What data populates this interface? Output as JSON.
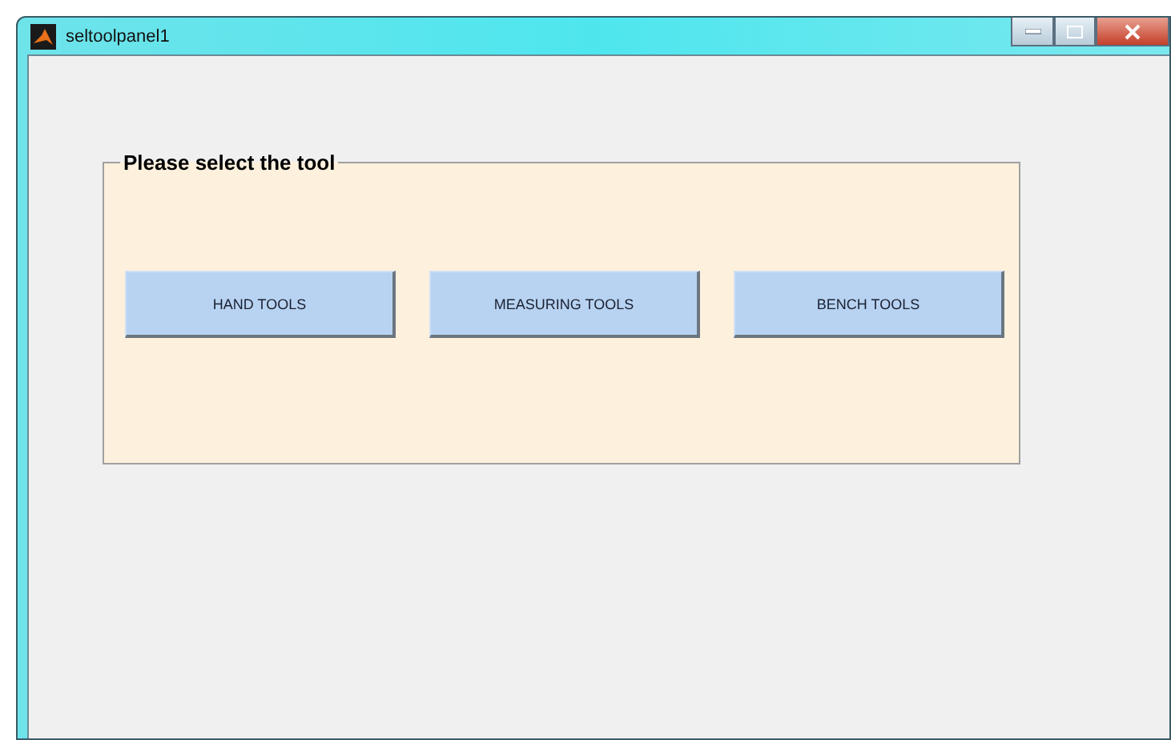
{
  "window": {
    "title": "seltoolpanel1"
  },
  "panel": {
    "title": "Please select the tool",
    "buttons": [
      "HAND TOOLS",
      "MEASURING TOOLS",
      "BENCH TOOLS"
    ]
  }
}
